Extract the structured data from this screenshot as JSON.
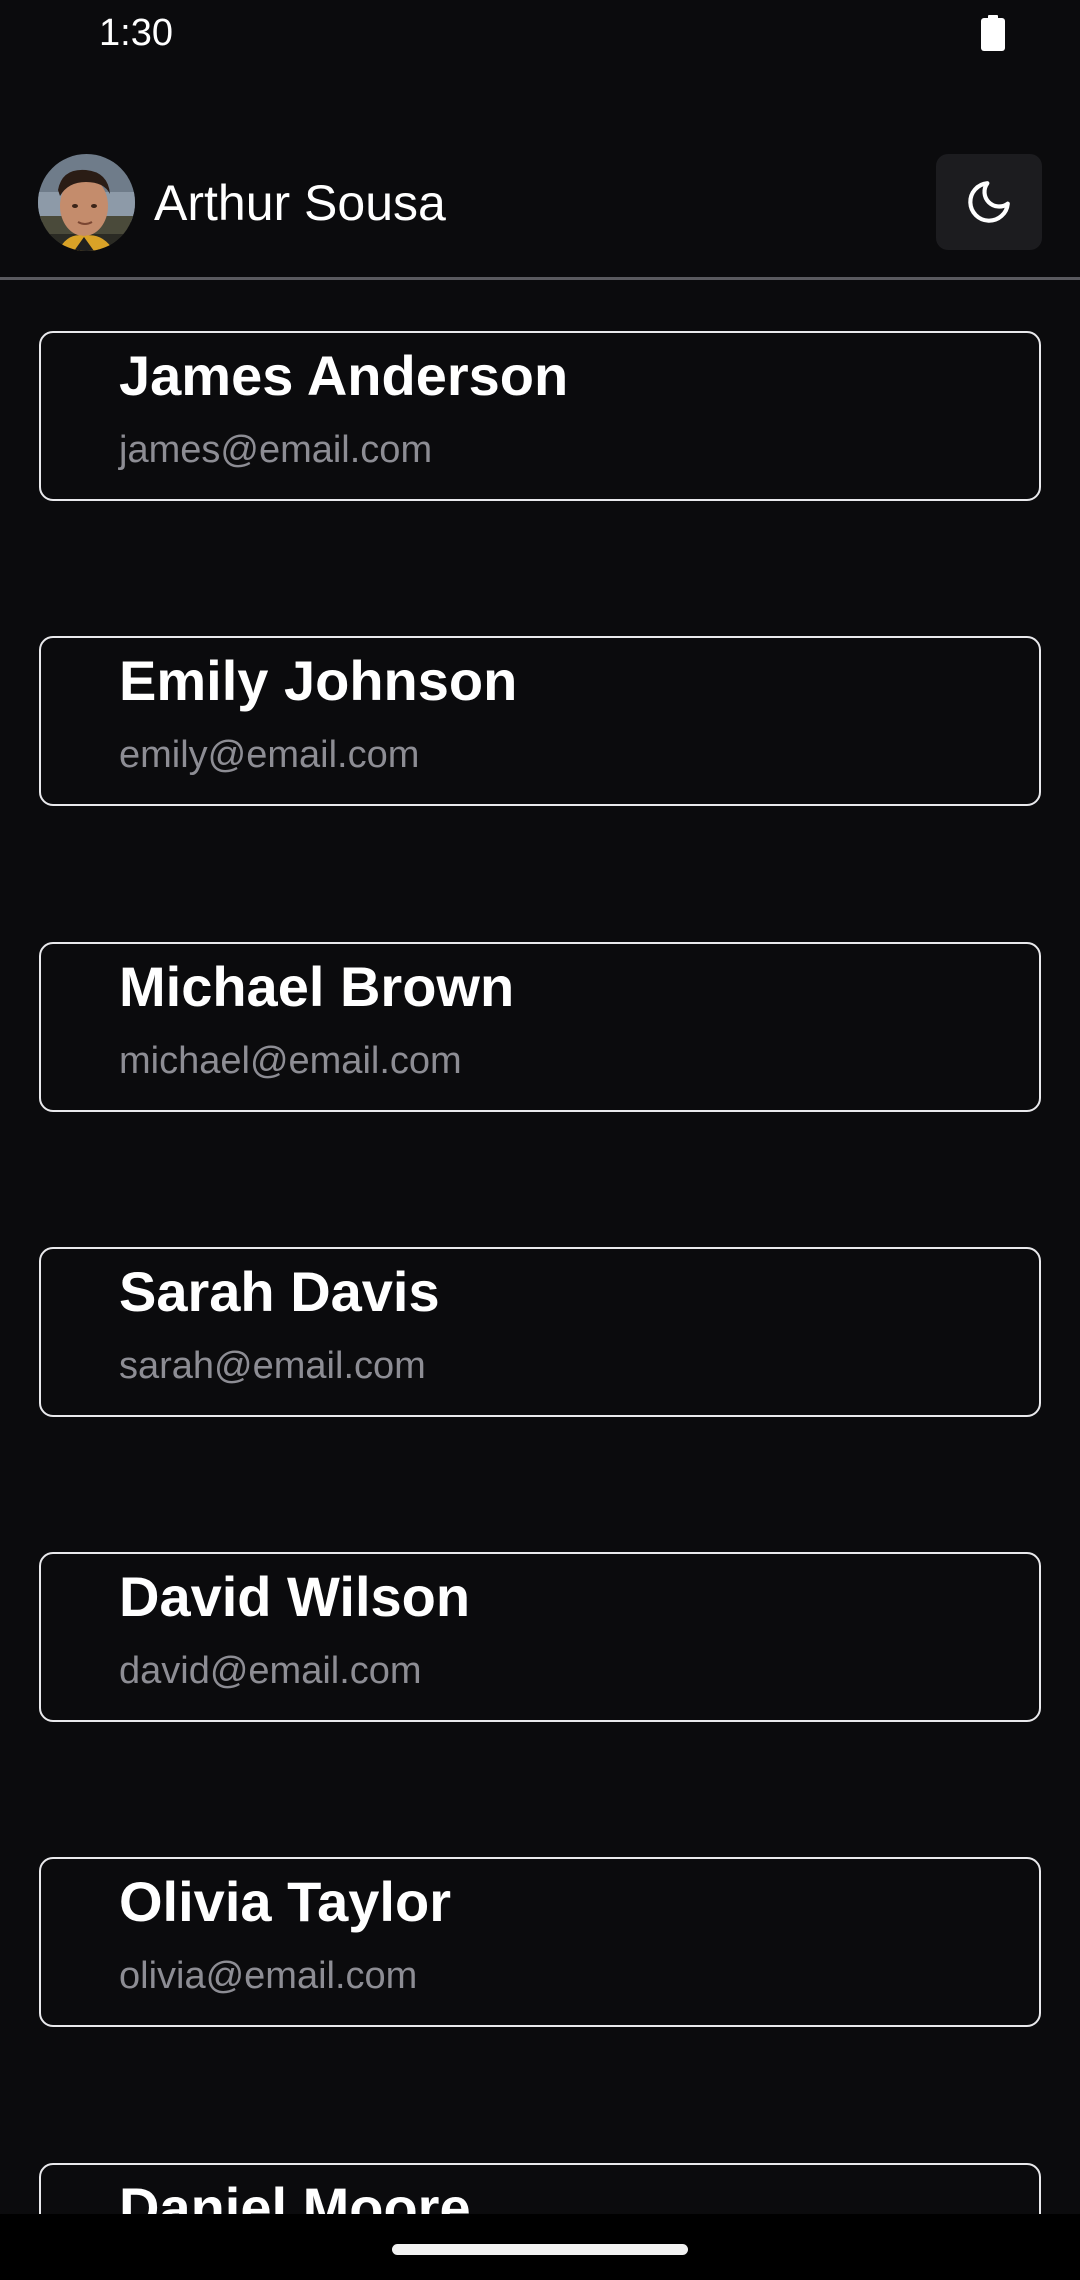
{
  "status_bar": {
    "time": "1:30",
    "battery_icon": "battery-full-icon"
  },
  "header": {
    "user_name": "Arthur Sousa",
    "avatar": "user-avatar-photo",
    "theme_toggle_icon": "moon-icon"
  },
  "contacts": [
    {
      "name": "James Anderson",
      "email": "james@email.com"
    },
    {
      "name": "Emily Johnson",
      "email": "emily@email.com"
    },
    {
      "name": "Michael Brown",
      "email": "michael@email.com"
    },
    {
      "name": "Sarah Davis",
      "email": "sarah@email.com"
    },
    {
      "name": "David Wilson",
      "email": "david@email.com"
    },
    {
      "name": "Olivia Taylor",
      "email": "olivia@email.com"
    },
    {
      "name": "Daniel Moore",
      "email": ""
    }
  ],
  "colors": {
    "background": "#0b0b0d",
    "card_border": "#e9e9ec",
    "secondary_text": "#8d8d94",
    "button_bg": "#1c1c1f"
  }
}
